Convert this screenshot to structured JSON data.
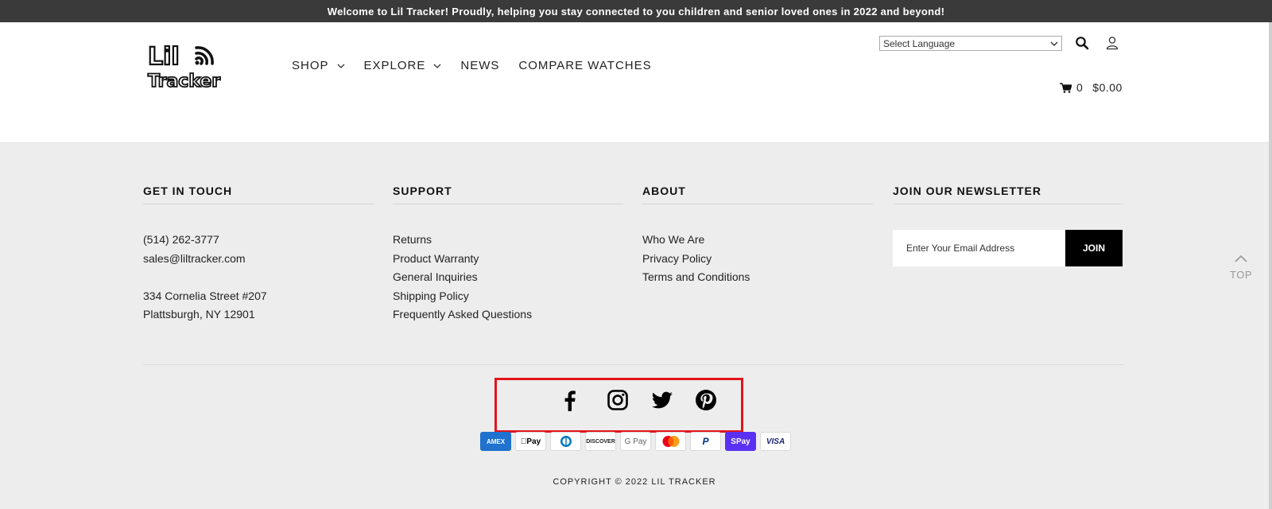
{
  "announcement": "Welcome to Lil Tracker! Proudly, helping you stay connected to you children and senior loved ones in 2022 and beyond!",
  "logo": {
    "line1": "Lil",
    "line2": "Tracker"
  },
  "nav": {
    "items": [
      {
        "label": "SHOP",
        "has_dropdown": true
      },
      {
        "label": "EXPLORE",
        "has_dropdown": true
      },
      {
        "label": "NEWS",
        "has_dropdown": false
      },
      {
        "label": "COMPARE WATCHES",
        "has_dropdown": false
      }
    ]
  },
  "header": {
    "language_select": "Select Language",
    "icons": [
      "search-icon",
      "user-icon"
    ],
    "cart": {
      "count": "0",
      "total": "$0.00",
      "icon": "cart-icon"
    }
  },
  "footer": {
    "contact": {
      "title": "GET IN TOUCH",
      "phone": "(514) 262-3777",
      "email": "sales@liltracker.com",
      "address1": "334 Cornelia Street #207",
      "address2": "Plattsburgh, NY 12901"
    },
    "support": {
      "title": "SUPPORT",
      "links": [
        "Returns",
        "Product Warranty",
        "General Inquiries",
        "Shipping Policy",
        "Frequently Asked Questions"
      ]
    },
    "about": {
      "title": "ABOUT",
      "links": [
        "Who We Are",
        "Privacy Policy",
        "Terms and Conditions"
      ]
    },
    "newsletter": {
      "title": "JOIN OUR NEWSLETTER",
      "placeholder": "Enter Your Email Address",
      "button": "JOIN"
    },
    "top_label": "TOP",
    "social": [
      "facebook-icon",
      "instagram-icon",
      "twitter-icon",
      "pinterest-icon"
    ],
    "payments": [
      {
        "name": "amex",
        "label": "AMEX",
        "color": "#1f72cd"
      },
      {
        "name": "apple-pay",
        "label": "Pay",
        "color": "#000000"
      },
      {
        "name": "diners",
        "label": "D",
        "color": "#0079be"
      },
      {
        "name": "discover",
        "label": "DISCOVER",
        "color": "#f48024"
      },
      {
        "name": "google-pay",
        "label": "G Pay",
        "color": "#5f6368"
      },
      {
        "name": "mastercard",
        "label": "",
        "color": "#eb001b"
      },
      {
        "name": "paypal",
        "label": "P",
        "color": "#003087"
      },
      {
        "name": "shop-pay",
        "label": "Pay",
        "color": "#5a31f4"
      },
      {
        "name": "visa",
        "label": "VISA",
        "color": "#1a1f71"
      }
    ],
    "copyright": "COPYRIGHT © 2022 LIL TRACKER",
    "highlight_color": "#e2151b"
  }
}
